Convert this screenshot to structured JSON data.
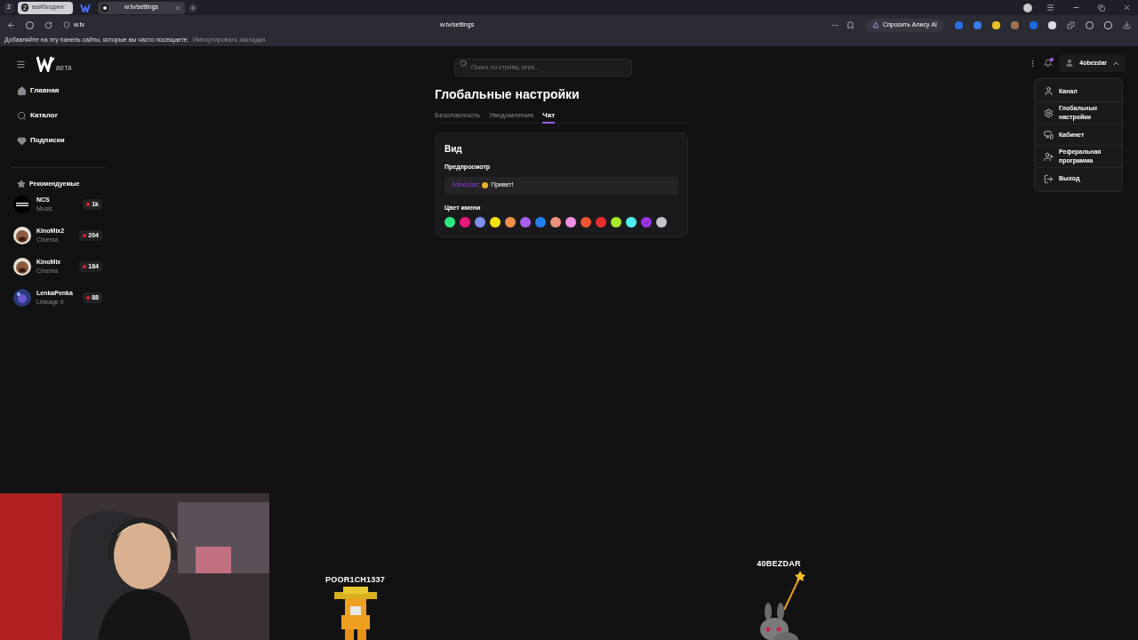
{
  "browser": {
    "tab_count": "2",
    "tab_group": {
      "count": "2",
      "label": "вайбкодинг"
    },
    "tabs": [
      {
        "label": "w.tv/settings",
        "selected": true
      }
    ],
    "address": {
      "host": "w.tv",
      "url": "w.tv/settings"
    },
    "alice_button": "Спросить Алису AI",
    "bookmarks_hint": "Добавляйте на эту панель сайты, которые вы часто посещаете.",
    "bookmarks_import": "Импортировать закладки"
  },
  "site": {
    "logo_tag": "BETA",
    "search": {
      "placeholder": "Поиск по стриму, игре..."
    },
    "user": "4obezdar",
    "notification_dot": true,
    "nav": [
      {
        "label": "Главная",
        "kind": "home"
      },
      {
        "label": "Каталог",
        "kind": "catalog"
      },
      {
        "label": "Подписки",
        "kind": "heart"
      }
    ],
    "recommended_title": "Рекомендуемые",
    "channels": [
      {
        "name": "NCS",
        "category": "Music",
        "viewers": "1k",
        "kind": "ncs"
      },
      {
        "name": "KinoMix2",
        "category": "Cinema",
        "viewers": "204",
        "kind": "face"
      },
      {
        "name": "KinoMix",
        "category": "Cinema",
        "viewers": "184",
        "kind": "face"
      },
      {
        "name": "LenkaPenka",
        "category": "Lineage II",
        "viewers": "88",
        "kind": "space"
      }
    ],
    "page_title": "Глобальные настройки",
    "tabs": [
      {
        "label": "Безопасность",
        "selected": false
      },
      {
        "label": "Уведомления",
        "selected": false
      },
      {
        "label": "Чат",
        "selected": true
      }
    ],
    "section_title": "Вид",
    "preview_label": "Предпросмотр",
    "preview": {
      "name": "4obezdar",
      "separator": ":",
      "message": "Привет!"
    },
    "color_label": "Цвет имени",
    "colors": [
      {
        "color": "#2ee882",
        "selected": false
      },
      {
        "color": "#e8187c",
        "selected": false
      },
      {
        "color": "#8090f2",
        "selected": false
      },
      {
        "color": "#f5e210",
        "selected": false
      },
      {
        "color": "#f0904c",
        "selected": false
      },
      {
        "color": "#a860f0",
        "selected": false
      },
      {
        "color": "#2080ec",
        "selected": false
      },
      {
        "color": "#ee907c",
        "selected": false
      },
      {
        "color": "#f090e4",
        "selected": false
      },
      {
        "color": "#ee5430",
        "selected": false
      },
      {
        "color": "#ea2c2c",
        "selected": false
      },
      {
        "color": "#a8e82c",
        "selected": false
      },
      {
        "color": "#4cf0ee",
        "selected": false
      },
      {
        "color": "#9c34e8",
        "selected": true
      },
      {
        "color": "#c4c4cc",
        "selected": false
      }
    ],
    "menu": [
      {
        "label": "Канал",
        "kind": "user"
      },
      {
        "label": "Глобальные настройки",
        "kind": "gear"
      },
      {
        "label": "Кабинет",
        "kind": "screen"
      },
      {
        "label": "Реферальная программа",
        "kind": "useradd"
      },
      {
        "label": "Выход",
        "kind": "logout"
      }
    ]
  },
  "stream_overlay": {
    "players": [
      {
        "name": "POOR1CH1337",
        "kind": "miner"
      },
      {
        "name": "40BEZDAR",
        "kind": "bunny"
      }
    ]
  }
}
